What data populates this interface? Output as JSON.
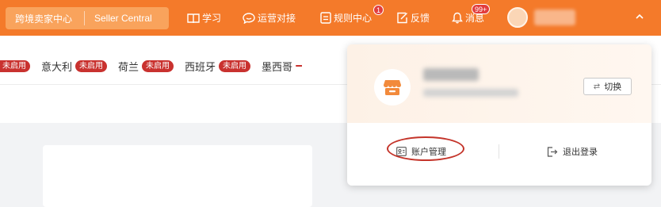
{
  "topbar": {
    "brand_cn": "跨境卖家中心",
    "brand_en": "Seller Central",
    "nav": [
      {
        "icon": "book-icon",
        "label": "学习"
      },
      {
        "icon": "chat-icon",
        "label": "运营对接"
      },
      {
        "icon": "document-icon",
        "label": "规则中心",
        "badge": "1"
      },
      {
        "icon": "edit-icon",
        "label": "反馈"
      },
      {
        "icon": "bell-icon",
        "label": "消息",
        "badge": "99+"
      }
    ],
    "colors": {
      "bar": "#f47a2a",
      "badge": "#e23d3d"
    }
  },
  "markets": [
    {
      "name": "",
      "status": "未启用"
    },
    {
      "name": "意大利",
      "status": "未启用"
    },
    {
      "name": "荷兰",
      "status": "未启用"
    },
    {
      "name": "西班牙",
      "status": "未启用"
    },
    {
      "name": "墨西哥",
      "status": ""
    }
  ],
  "account_panel": {
    "switch_label": "切换",
    "switch_icon": "swap-icon",
    "account_manage_label": "账户管理",
    "account_manage_icon": "id-card-icon",
    "logout_label": "退出登录",
    "logout_icon": "logout-icon",
    "store_icon": "store-icon"
  }
}
